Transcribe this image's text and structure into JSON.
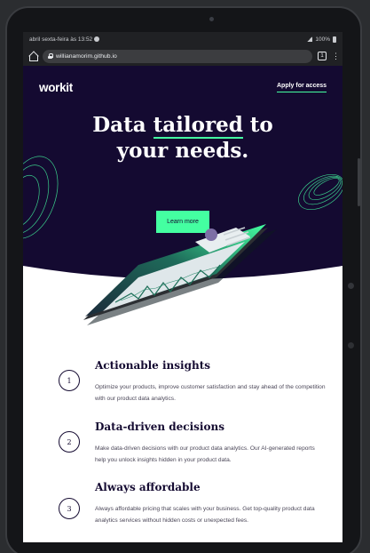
{
  "status_bar": {
    "time": "abril sexta-feira às 13:52",
    "battery": "100%"
  },
  "browser": {
    "url": "willianamorim.github.io",
    "tab_count": "1",
    "menu": "⋮"
  },
  "header": {
    "logo": "workit",
    "apply_label": "Apply for access"
  },
  "hero": {
    "title_part1": "Data ",
    "title_underlined": "tailored",
    "title_part2": " to",
    "title_line2": "your needs.",
    "cta_label": "Learn more"
  },
  "features": [
    {
      "number": "1",
      "title": "Actionable insights",
      "text": "Optimize your products, improve customer satisfaction and stay ahead of the competition with our product data analytics."
    },
    {
      "number": "2",
      "title": "Data-driven decisions",
      "text": "Make data-driven decisions with our product data analytics. Our AI-generated reports help you unlock insights hidden in your product data."
    },
    {
      "number": "3",
      "title": "Always affordable",
      "text": "Always affordable pricing that scales with your business. Get top-quality product data analytics services without hidden costs or unexpected fees."
    }
  ],
  "colors": {
    "hero_bg": "#140a31",
    "accent": "#44ffa1",
    "text_dark": "#140a31"
  }
}
